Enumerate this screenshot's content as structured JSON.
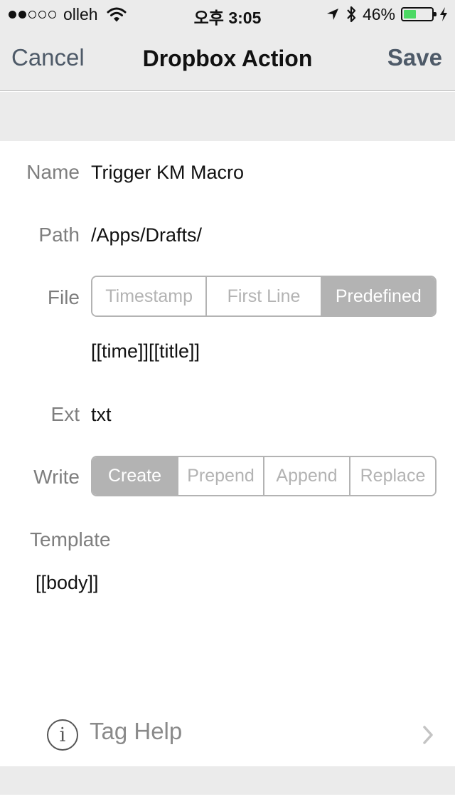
{
  "status_bar": {
    "carrier": "olleh",
    "time": "오후 3:05",
    "battery_percent": "46%",
    "battery_level": 0.46,
    "battery_color": "#4cd964",
    "signal_bars_filled": 2,
    "signal_bars_total": 5,
    "icons": [
      "wifi-icon",
      "location-arrow-icon",
      "bluetooth-icon",
      "battery-icon",
      "charging-bolt-icon"
    ]
  },
  "nav": {
    "cancel": "Cancel",
    "title": "Dropbox Action",
    "save": "Save"
  },
  "form": {
    "name": {
      "label": "Name",
      "value": "Trigger KM Macro"
    },
    "path": {
      "label": "Path",
      "value": "/Apps/Drafts/"
    },
    "file": {
      "label": "File",
      "options": [
        "Timestamp",
        "First Line",
        "Predefined"
      ],
      "selected": "Predefined",
      "predefined_value": "[[time]][[title]]"
    },
    "ext": {
      "label": "Ext",
      "value": "txt"
    },
    "write": {
      "label": "Write",
      "options": [
        "Create",
        "Prepend",
        "Append",
        "Replace"
      ],
      "selected": "Create"
    },
    "template": {
      "label": "Template",
      "value": "[[body]]"
    }
  },
  "tag_help": {
    "label": "Tag Help",
    "icon": "info-icon",
    "chevron": "chevron-right-icon"
  },
  "colors": {
    "bar_background": "#ebebeb",
    "nav_button": "#4e5a68",
    "label_gray": "#7e7e7e",
    "segment_gray": "#b3b3b3"
  }
}
